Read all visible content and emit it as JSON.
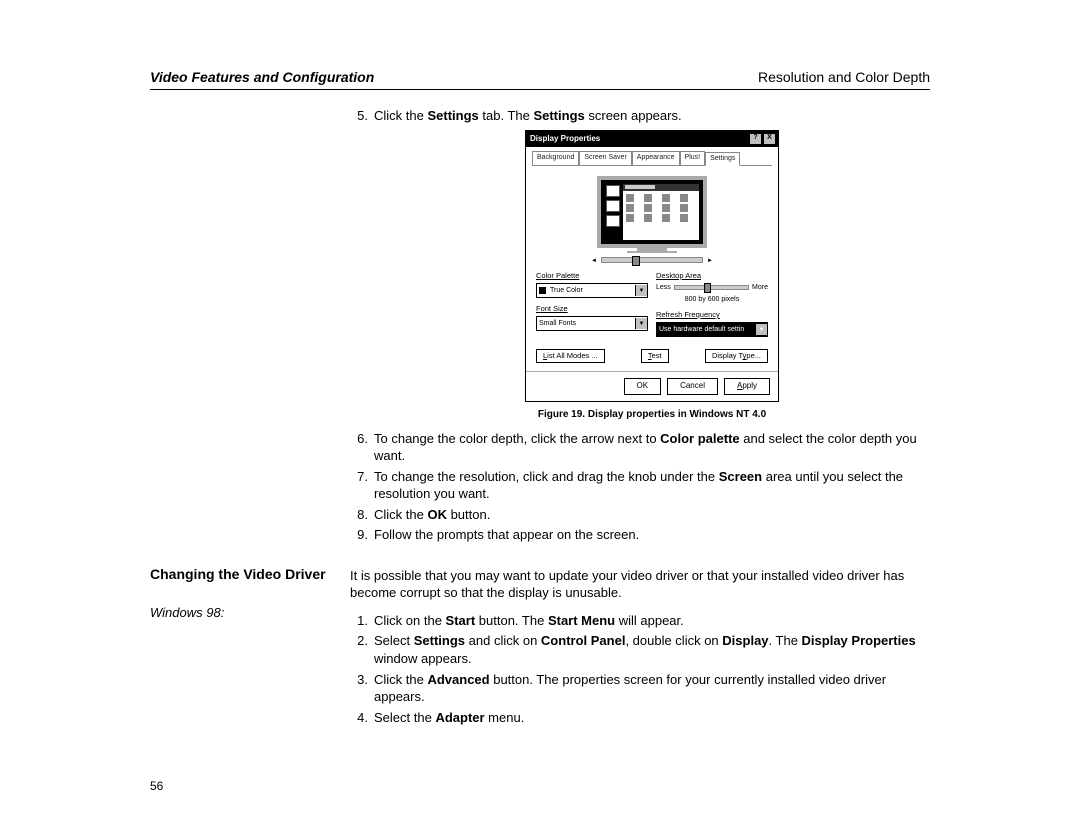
{
  "header": {
    "left": "Video Features and Configuration",
    "right": "Resolution and Color Depth"
  },
  "step5": {
    "num": "5.",
    "pre": "Click the ",
    "b1": "Settings",
    "mid": " tab. The ",
    "b2": "Settings",
    "post": " screen appears."
  },
  "dialog": {
    "title": "Display Properties",
    "help": "?",
    "close": "X",
    "tabs": {
      "background": "Background",
      "screensaver": "Screen Saver",
      "appearance": "Appearance",
      "plus": "Plus!",
      "settings": "Settings"
    },
    "labels": {
      "colorPalette": "Color Palette",
      "desktopArea": "Desktop Area",
      "less": "Less",
      "more": "More",
      "resolution": "800 by 600 pixels",
      "fontSize": "Font Size",
      "refresh": "Refresh Frequency"
    },
    "values": {
      "colorPalette": "True Color",
      "fontSize": "Small Fonts",
      "refresh": "Use hardware default settin"
    },
    "buttons": {
      "listAllModes": "List All Modes ...",
      "test": "Test",
      "displayType": "Display Type...",
      "ok": "OK",
      "cancel": "Cancel",
      "apply": "Apply"
    }
  },
  "caption": "Figure 19.  Display properties in Windows NT 4.0",
  "step6": {
    "num": "6.",
    "pre": "To change the color depth, click the arrow next to ",
    "b": "Color palette",
    "post": " and select the color depth you want."
  },
  "step7": {
    "num": "7.",
    "pre": "To change the resolution, click and drag the knob under the ",
    "b": "Screen",
    "post": " area until you select the resolution you want."
  },
  "step8": {
    "num": "8.",
    "pre": "Click the ",
    "b": "OK",
    "post": " button."
  },
  "step9": {
    "num": "9.",
    "txt": "Follow the prompts that appear on the screen."
  },
  "section2": {
    "heading": "Changing the Video Driver",
    "intro": "It is possible that you may want to update your video driver or that your installed video driver has become corrupt so that the display is unusable.",
    "subhead": "Windows 98:"
  },
  "w98": {
    "s1": {
      "num": "1.",
      "pre": "Click on the ",
      "b1": "Start",
      "mid": " button. The ",
      "b2": "Start Menu",
      "post": " will appear."
    },
    "s2": {
      "num": "2.",
      "pre": "Select ",
      "b1": "Settings",
      "mid1": " and click on ",
      "b2": "Control Panel",
      "mid2": ", double click on ",
      "b3": "Display",
      "mid3": ". The ",
      "b4": "Display Properties",
      "post": " window appears."
    },
    "s3": {
      "num": "3.",
      "pre": "Click the ",
      "b": "Advanced",
      "post": " button. The properties screen for your currently installed video driver appears."
    },
    "s4": {
      "num": "4.",
      "pre": "Select the ",
      "b": "Adapter",
      "post": " menu."
    }
  },
  "pageNum": "56"
}
